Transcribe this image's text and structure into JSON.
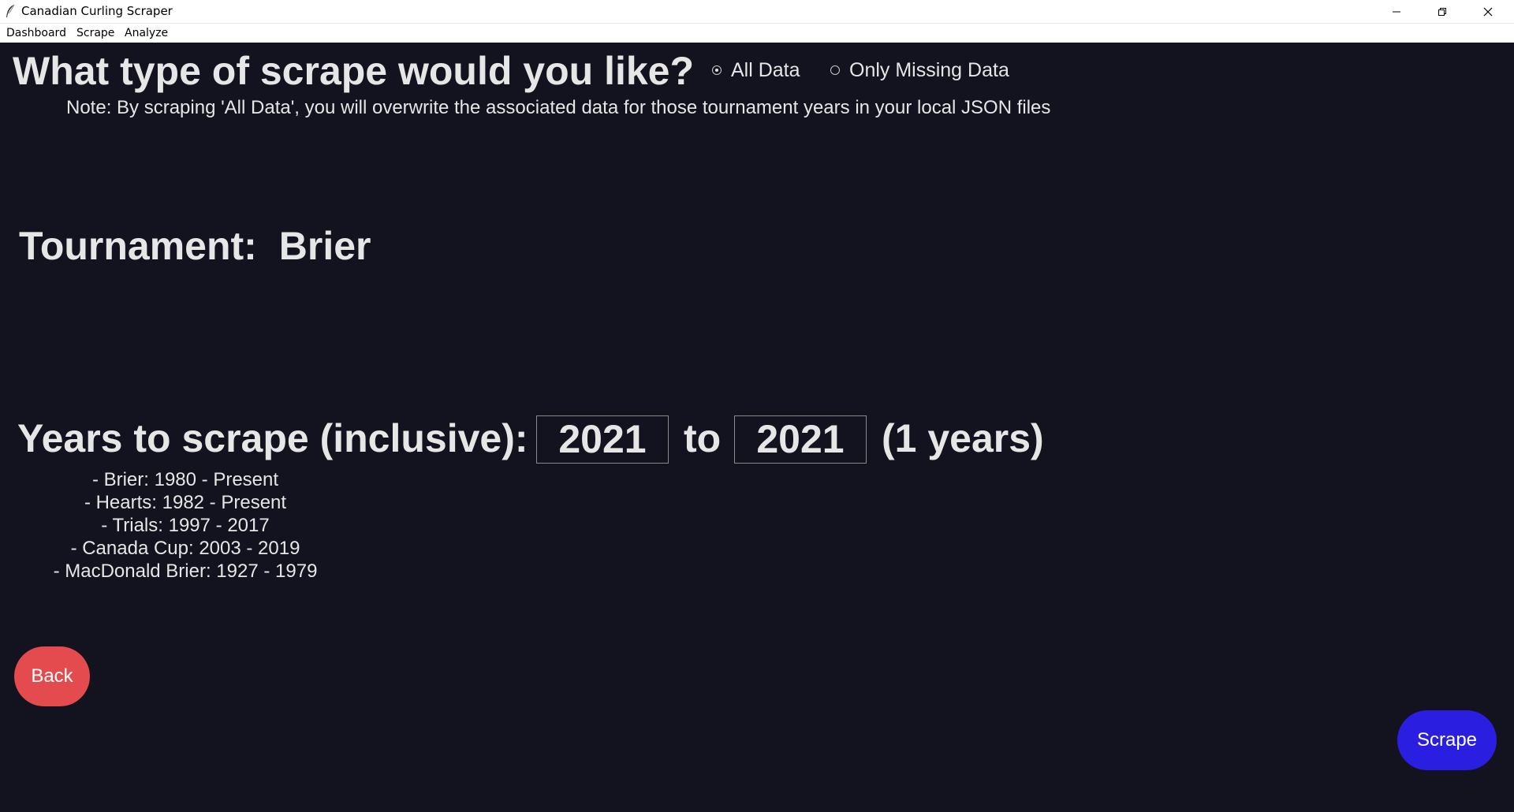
{
  "window": {
    "title": "Canadian Curling Scraper"
  },
  "menu": {
    "items": [
      "Dashboard",
      "Scrape",
      "Analyze"
    ]
  },
  "scrape_type": {
    "heading": "What type of scrape would you like?",
    "options": [
      {
        "label": "All Data",
        "selected": true
      },
      {
        "label": "Only Missing Data",
        "selected": false
      }
    ],
    "note": "Note: By scraping 'All Data', you will overwrite the associated data for those tournament years in your local JSON files"
  },
  "tournament": {
    "label": "Tournament:",
    "value": "Brier"
  },
  "years": {
    "label": "Years to scrape (inclusive):",
    "from": "2021",
    "to_label": "to",
    "to": "2021",
    "count_text": "(1 years)"
  },
  "ranges": [
    "- Brier: 1980 - Present",
    "- Hearts: 1982 - Present",
    "- Trials: 1997 - 2017",
    "- Canada Cup: 2003 - 2019",
    "- MacDonald Brier: 1927 - 1979"
  ],
  "buttons": {
    "back": "Back",
    "scrape": "Scrape"
  },
  "colors": {
    "background": "#13131f",
    "back_button": "#e34b4e",
    "scrape_button": "#2a1fe0"
  }
}
